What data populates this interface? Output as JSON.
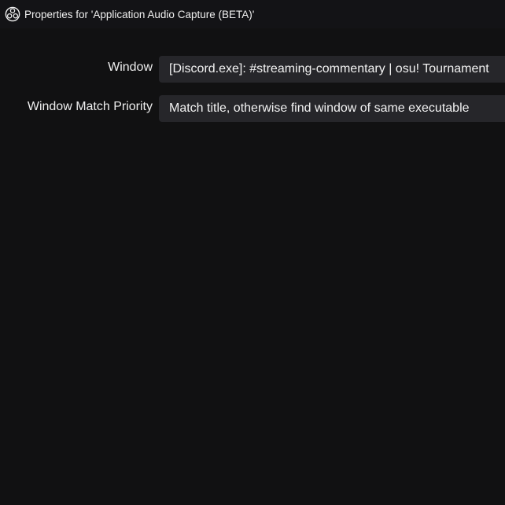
{
  "window": {
    "title": "Properties for 'Application Audio Capture (BETA)'",
    "icon": "obs-logo-icon"
  },
  "form": {
    "rows": [
      {
        "label": "Window",
        "value": "[Discord.exe]: #streaming-commentary | osu! Tournament"
      },
      {
        "label": "Window Match Priority",
        "value": "Match title, otherwise find window of same executable"
      }
    ]
  },
  "colors": {
    "background": "#111112",
    "titlebar": "#131316",
    "field": "#26262a",
    "text": "#eeeeee"
  }
}
